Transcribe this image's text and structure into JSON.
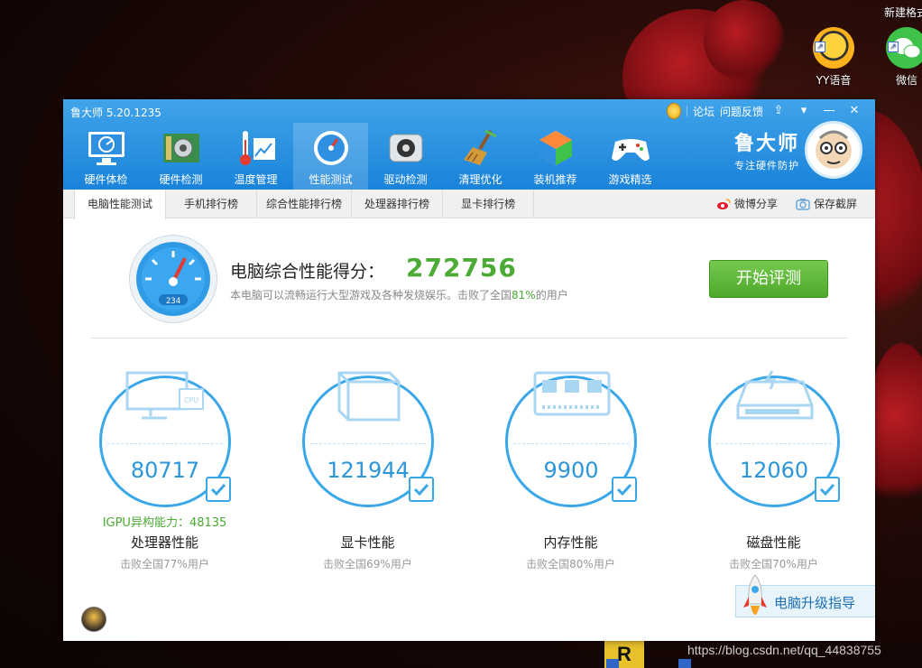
{
  "desktop": {
    "top_right_text": "新建格式",
    "icons": [
      {
        "label": "YY语音"
      },
      {
        "label": "微信"
      }
    ],
    "watermark": "https://blog.csdn.net/qq_44838755",
    "taskbar_letter": "R"
  },
  "window": {
    "title": "鲁大师 5.20.1235",
    "links": {
      "forum": "论坛",
      "feedback": "问题反馈"
    },
    "nav": [
      {
        "label": "硬件体检",
        "icon": "monitor-icon"
      },
      {
        "label": "硬件检测",
        "icon": "board-icon"
      },
      {
        "label": "温度管理",
        "icon": "thermometer-icon"
      },
      {
        "label": "性能测试",
        "icon": "speedometer-icon",
        "active": true
      },
      {
        "label": "驱动检测",
        "icon": "gear-box-icon"
      },
      {
        "label": "清理优化",
        "icon": "broom-icon"
      },
      {
        "label": "装机推荐",
        "icon": "cube-icon"
      },
      {
        "label": "游戏精选",
        "icon": "gamepad-icon"
      }
    ],
    "brand": {
      "name": "鲁大师",
      "slogan": "专注硬件防护"
    }
  },
  "subtabs": [
    "电脑性能测试",
    "手机排行榜",
    "综合性能排行榜",
    "处理器排行榜",
    "显卡排行榜"
  ],
  "share": {
    "weibo": "微博分享",
    "screenshot": "保存截屏"
  },
  "score": {
    "title": "电脑综合性能得分：",
    "value": "272756",
    "desc_prefix": "本电脑可以流畅运行大型游戏及各种发烧娱乐。击败了全国",
    "percent": "81%",
    "desc_suffix": "的用户",
    "gauge_reading": "234",
    "start_button": "开始评测"
  },
  "metrics": [
    {
      "name": "处理器性能",
      "value": "80717",
      "sub": "击败全国77%用户",
      "extra": "IGPU异构能力：48135",
      "icon": "cpu-monitor-icon"
    },
    {
      "name": "显卡性能",
      "value": "121944",
      "sub": "击败全国69%用户",
      "extra": "",
      "icon": "graphics-box-icon"
    },
    {
      "name": "内存性能",
      "value": "9900",
      "sub": "击败全国80%用户",
      "extra": "",
      "icon": "memory-chip-icon"
    },
    {
      "name": "磁盘性能",
      "value": "12060",
      "sub": "击败全国70%用户",
      "extra": "",
      "icon": "disk-drive-icon"
    }
  ],
  "guide": {
    "label": "电脑升级指导"
  },
  "colors": {
    "accent_blue": "#1a83da",
    "score_green": "#4bab34",
    "ring_blue": "#3aa7e8"
  }
}
